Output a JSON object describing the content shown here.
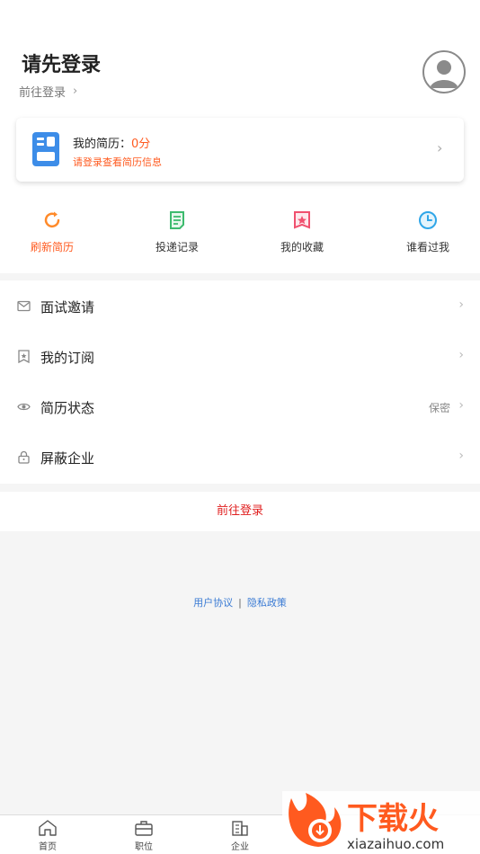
{
  "header": {
    "title": "请先登录",
    "login_link": "前往登录",
    "avatar_icon": "user-avatar-icon"
  },
  "resume_card": {
    "label": "我的简历：",
    "score": "0分",
    "hint": "请登录查看简历信息",
    "icon": "resume-icon"
  },
  "quick_actions": [
    {
      "label": "刷新简历",
      "icon": "refresh-icon",
      "color": "#ff8a2a"
    },
    {
      "label": "投递记录",
      "icon": "document-icon",
      "color": "#3dbb6e"
    },
    {
      "label": "我的收藏",
      "icon": "bookmark-star-icon",
      "color": "#f0506e"
    },
    {
      "label": "谁看过我",
      "icon": "clock-icon",
      "color": "#2fa6e8"
    }
  ],
  "menu": [
    {
      "label": "面试邀请",
      "icon": "mail-icon",
      "value": ""
    },
    {
      "label": "我的订阅",
      "icon": "bookmark-icon",
      "value": ""
    },
    {
      "label": "简历状态",
      "icon": "eye-icon",
      "value": "保密"
    },
    {
      "label": "屏蔽企业",
      "icon": "lock-icon",
      "value": ""
    }
  ],
  "login_button": "前往登录",
  "footer_links": {
    "agreement": "用户协议",
    "separator": "|",
    "privacy": "隐私政策"
  },
  "tabbar": [
    {
      "label": "首页",
      "icon": "home-icon"
    },
    {
      "label": "职位",
      "icon": "briefcase-icon"
    },
    {
      "label": "企业",
      "icon": "building-icon"
    }
  ],
  "watermark": {
    "brand": "下载火",
    "url": "xiazaihuo.com"
  },
  "colors": {
    "accent": "#ff5a1f",
    "login_red": "#e02020",
    "link_blue": "#3b7bd4"
  }
}
